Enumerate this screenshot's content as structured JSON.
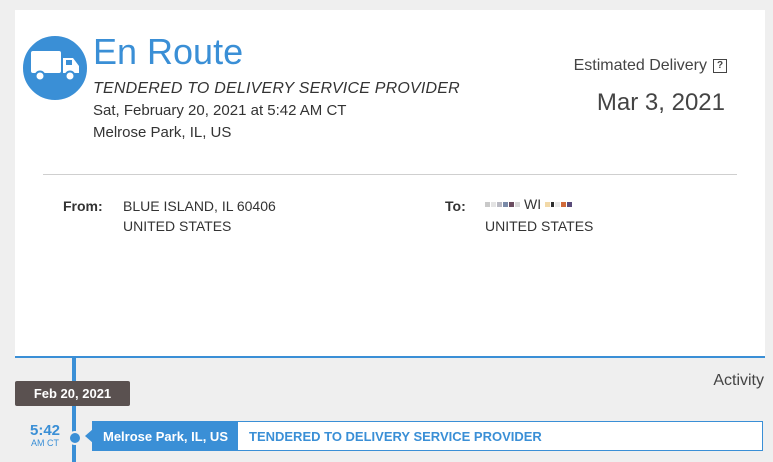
{
  "colors": {
    "accent": "#3a8fd6",
    "badge_bg": "#5a5150",
    "page_bg": "#efefef"
  },
  "icons": {
    "status": "truck-icon",
    "help": "help-square-icon"
  },
  "status": {
    "title": "En Route",
    "subtitle": "TENDERED TO DELIVERY SERVICE PROVIDER",
    "datetime": "Sat, February 20, 2021 at 5:42 AM CT",
    "location": "Melrose Park, IL, US"
  },
  "estimated": {
    "label": "Estimated Delivery",
    "help_glyph": "?",
    "date": "Mar 3, 2021"
  },
  "from": {
    "label": "From:",
    "line1": "BLUE ISLAND, IL 60406",
    "line2": "UNITED STATES"
  },
  "to": {
    "label": "To:",
    "state": "WI",
    "line2": "UNITED STATES"
  },
  "activity": {
    "label": "Activity",
    "groups": [
      {
        "date": "Feb 20, 2021",
        "events": [
          {
            "time": "5:42",
            "ampm": "AM CT",
            "location": "Melrose Park, IL, US",
            "description": "TENDERED TO DELIVERY SERVICE PROVIDER"
          }
        ]
      }
    ]
  }
}
